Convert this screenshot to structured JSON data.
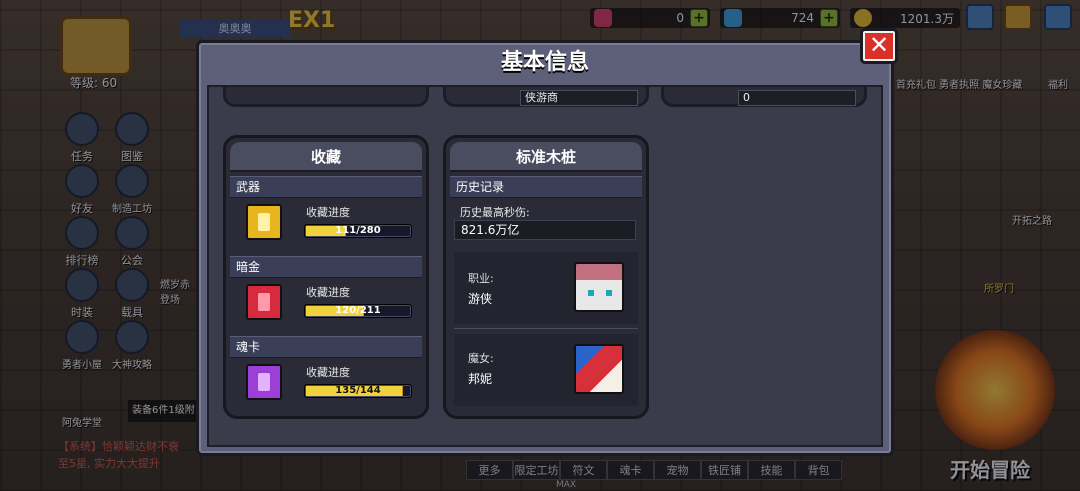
{
  "hud": {
    "currency_1": "0",
    "currency_2": "724",
    "currency_3": "1201.3万",
    "player_name": "奥奥奥",
    "ex_tag": "EX1",
    "level": "等级: 60",
    "colors": {
      "gem": "#e0406a",
      "diamond": "#3ca7e8",
      "coin": "#f2c430",
      "plus": "#9bc53d"
    }
  },
  "left_menu": [
    {
      "label": "任务"
    },
    {
      "label": "图鉴"
    },
    {
      "label": "好友"
    },
    {
      "label": "制造工坊"
    },
    {
      "label": "排行榜"
    },
    {
      "label": "公会"
    },
    {
      "label": "时装"
    },
    {
      "label": "载具"
    },
    {
      "label": "勇者小屋"
    },
    {
      "label": "大神攻略"
    }
  ],
  "left_menu_extra": "燃岁赤 登场",
  "right_menu": {
    "top_labels": "首充礼包 勇者执照 魔女珍藏",
    "welfare": "福利",
    "pioneer": "开拓之路",
    "next": "所罗门"
  },
  "academy_label": "阿兔学堂",
  "equip_tip": "装备6件1级附",
  "chat": {
    "line1": "【系统】恰颖颖达财不衰",
    "line2": "至5星, 实力大大提升"
  },
  "bottom_bar": [
    "更多",
    "限定工坊",
    "符文",
    "魂卡",
    "宠物",
    "铁匠铺",
    "技能",
    "背包"
  ],
  "max_label": "MAX",
  "start_button": "开始冒险",
  "modal": {
    "title": "基本信息",
    "close_label": "✕",
    "top_fields": {
      "middle": "侠游商",
      "right": "0"
    },
    "collection": {
      "header": "收藏",
      "progress_label": "收藏进度",
      "categories": [
        {
          "name": "武器",
          "progress": "111/280",
          "current": 111,
          "total": 280,
          "color": "#e7b51d"
        },
        {
          "name": "暗金",
          "progress": "120/211",
          "current": 120,
          "total": 211,
          "color": "#d62b3f"
        },
        {
          "name": "魂卡",
          "progress": "135/144",
          "current": 135,
          "total": 144,
          "color": "#9b3fd6"
        }
      ]
    },
    "dummy": {
      "header": "标准木桩",
      "history_title": "历史记录",
      "max_dps_label": "历史最高秒伤:",
      "max_dps_value": "821.6万亿",
      "characters": [
        {
          "role_label": "职业:",
          "role_value": "游侠"
        },
        {
          "role_label": "魔女:",
          "role_value": "邦妮"
        }
      ]
    }
  }
}
